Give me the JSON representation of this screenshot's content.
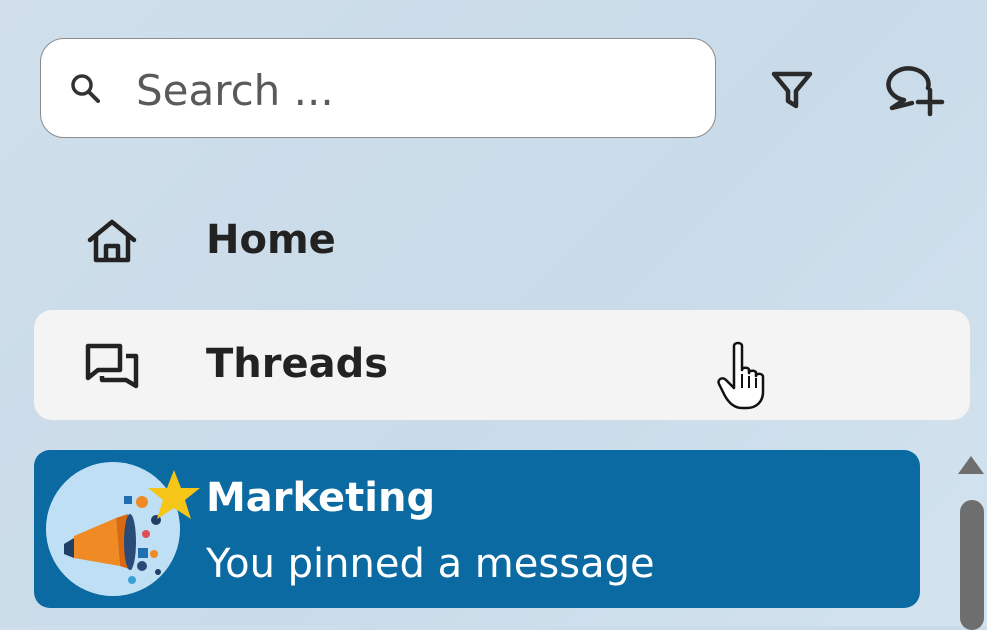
{
  "search": {
    "placeholder": "Search ...",
    "value": "",
    "icon": "search-icon"
  },
  "toolbar": {
    "filter_icon": "filter-icon",
    "new_chat_icon": "new-chat-icon"
  },
  "nav": {
    "items": [
      {
        "label": "Home",
        "icon": "home-icon",
        "active": false
      },
      {
        "label": "Threads",
        "icon": "threads-icon",
        "hovered": true
      }
    ]
  },
  "chats": [
    {
      "name": "Marketing",
      "preview": "You pinned a message",
      "favorite": true,
      "selected": true,
      "avatar_icon": "marketing-megaphone-avatar"
    }
  ],
  "colors": {
    "background": "#cfdeea",
    "selected_chat": "#0a6aa1",
    "hover_item": "#f4f4f4",
    "star": "#f5c518",
    "text": "#222222"
  }
}
